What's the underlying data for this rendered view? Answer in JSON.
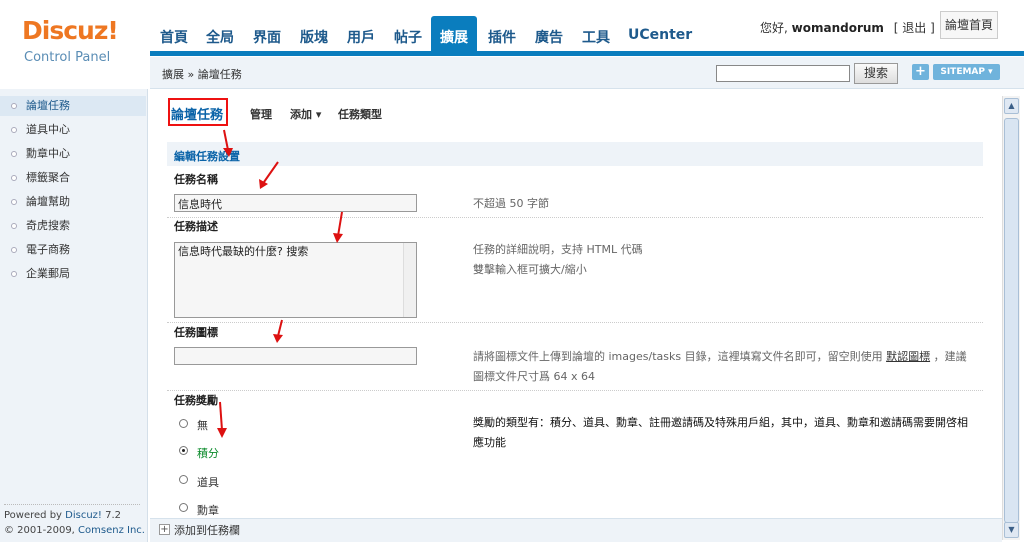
{
  "brand": {
    "name": "Discuz!",
    "subtitle": "Control Panel"
  },
  "nav": {
    "tabs": [
      "首頁",
      "全局",
      "界面",
      "版塊",
      "用戶",
      "帖子",
      "擴展",
      "插件",
      "廣告",
      "工具",
      "UCenter"
    ],
    "active": "擴展"
  },
  "user": {
    "greeting": "您好,",
    "name": "womandorum",
    "logout": "[ 退出 ]",
    "home": "論壇首頁"
  },
  "crumb": {
    "text": "擴展 » 論壇任務"
  },
  "search": {
    "button": "搜索",
    "value": ""
  },
  "toolbar": {
    "plus": "+",
    "sitemap": "SITEMAP ▾"
  },
  "sidebar": {
    "items": [
      "論壇任務",
      "道具中心",
      "勳章中心",
      "標籤聚合",
      "論壇幫助",
      "奇虎搜索",
      "電子商務",
      "企業郵局"
    ],
    "active": "論壇任務",
    "powered_prefix": "Powered by ",
    "powered_link": "Discuz!",
    "powered_version": " 7.2",
    "copyright_prefix": "© 2001-2009, ",
    "copyright_link": "Comsenz Inc."
  },
  "page": {
    "title": "論壇任務",
    "subtabs": [
      "管理",
      "添加 ▾",
      "任務類型"
    ],
    "section_title": "編輯任務設置"
  },
  "form": {
    "name_label": "任務名稱",
    "name_value": "信息時代",
    "name_hint": "不超過 50 字節",
    "desc_label": "任務描述",
    "desc_value": "信息時代最缺的什麼? 搜索",
    "desc_hint_1": "任務的詳細說明，支持 HTML 代碼",
    "desc_hint_2": "雙擊輸入框可擴大/縮小",
    "icon_label": "任務圖標",
    "icon_value": "",
    "icon_hint_1": "請將圖標文件上傳到論壇的 images/tasks 目錄，這裡填寫文件名即可，留空則使用",
    "icon_hint_link": "默認圖標",
    "icon_hint_2": "，建議",
    "icon_hint_3": "圖標文件尺寸爲 64 x 64",
    "reward_label": "任務獎勵",
    "reward_options": [
      "無",
      "積分",
      "道具",
      "勳章"
    ],
    "reward_selected": "積分",
    "reward_hint": "獎勵的類型有：積分、道具、勳章、註冊邀請碼及特殊用戶組，其中，道具、勳章和邀請碼需要開啓相應功能"
  },
  "footer": {
    "add_label": "添加到任務欄"
  },
  "colors": {
    "accent": "#0a7dbe",
    "brand_orange": "#ee7722",
    "annotation": "#dd1111"
  }
}
